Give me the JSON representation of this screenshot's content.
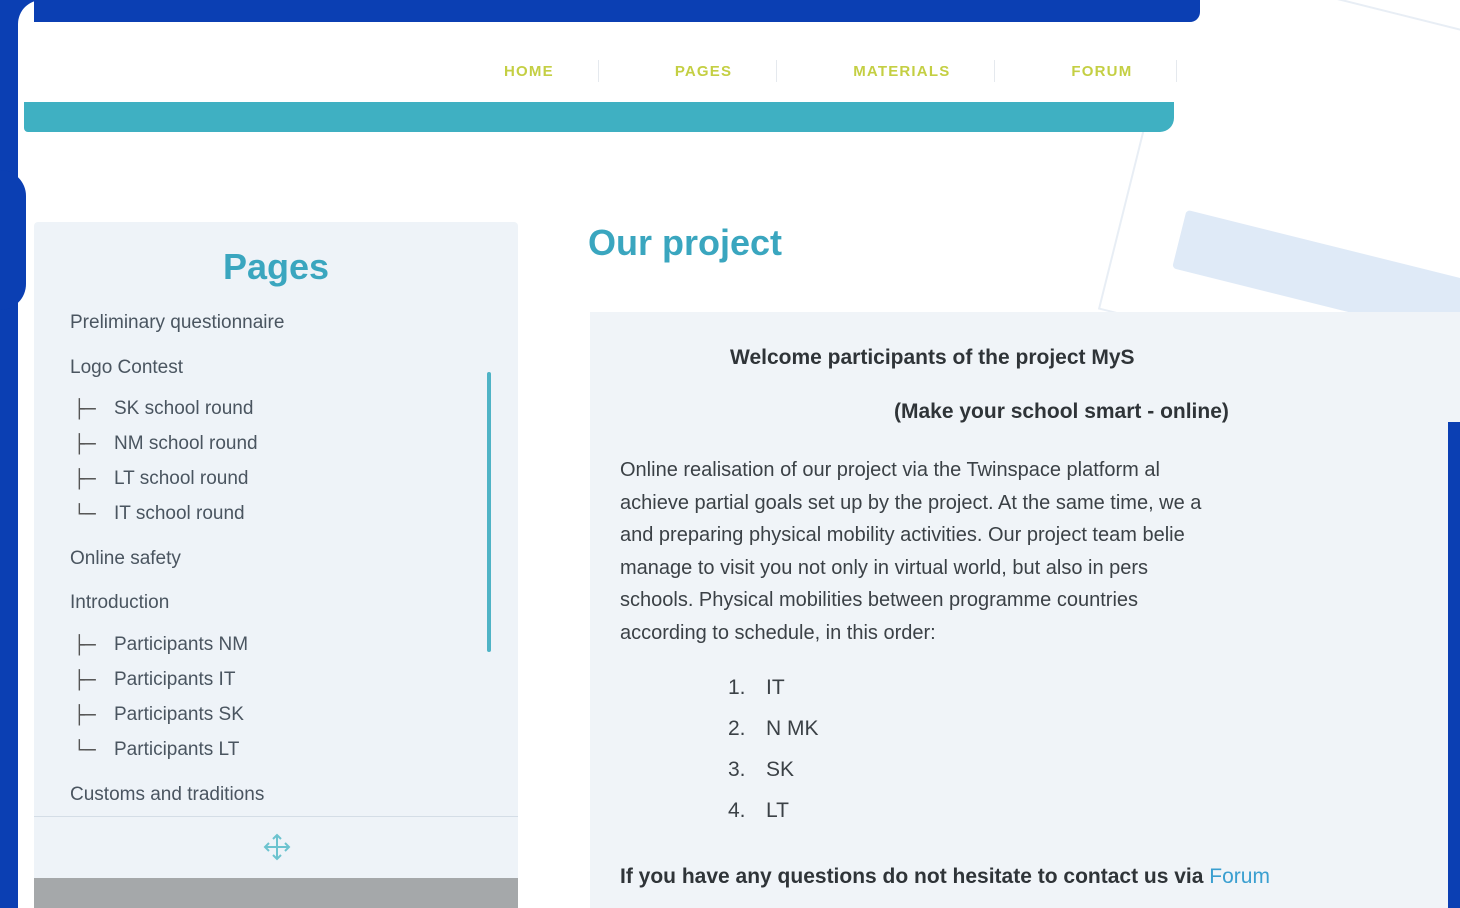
{
  "nav": {
    "items": [
      "HOME",
      "PAGES",
      "MATERIALS",
      "FORUM"
    ]
  },
  "sidebar": {
    "title": "Pages",
    "items": [
      {
        "label": "Preliminary questionnaire"
      },
      {
        "label": "Logo Contest"
      },
      {
        "label": "SK school round",
        "tree": "├─"
      },
      {
        "label": "NM school round",
        "tree": "├─"
      },
      {
        "label": "LT school round",
        "tree": "├─"
      },
      {
        "label": "IT school round",
        "tree": "└─"
      },
      {
        "label": "Online safety"
      },
      {
        "label": "Introduction"
      },
      {
        "label": "Participants NM",
        "tree": "├─"
      },
      {
        "label": "Participants IT",
        "tree": "├─"
      },
      {
        "label": "Participants SK",
        "tree": "├─"
      },
      {
        "label": "Participants LT",
        "tree": "└─"
      },
      {
        "label": "Customs and traditions"
      }
    ],
    "move_icon": "move-icon"
  },
  "main": {
    "title": "Our project",
    "welcome": "Welcome participants of the project MyS",
    "subtitle": "(Make your school smart - online)",
    "paragraph_lines": [
      "Online realisation of our project via the Twinspace platform al",
      "achieve partial goals set up by the project. At the same time, we a",
      "and preparing physical mobility activities. Our project team belie",
      "manage to visit you not only in virtual world, but also in pers",
      "schools. Physical mobilities between programme countries",
      "according to schedule, in this order:"
    ],
    "order": [
      {
        "num": "1.",
        "country": "IT"
      },
      {
        "num": "2.",
        "country": "N MK"
      },
      {
        "num": "3.",
        "country": "SK"
      },
      {
        "num": "4.",
        "country": "LT"
      }
    ],
    "contact_text": "If you have any questions do not hesitate to contact us via",
    "contact_link": "Forum"
  },
  "colors": {
    "frame_blue": "#0b3fb3",
    "accent_teal": "#3aa6bf",
    "nav_text": "#c4cf43",
    "link_blue": "#3a9fd0"
  }
}
